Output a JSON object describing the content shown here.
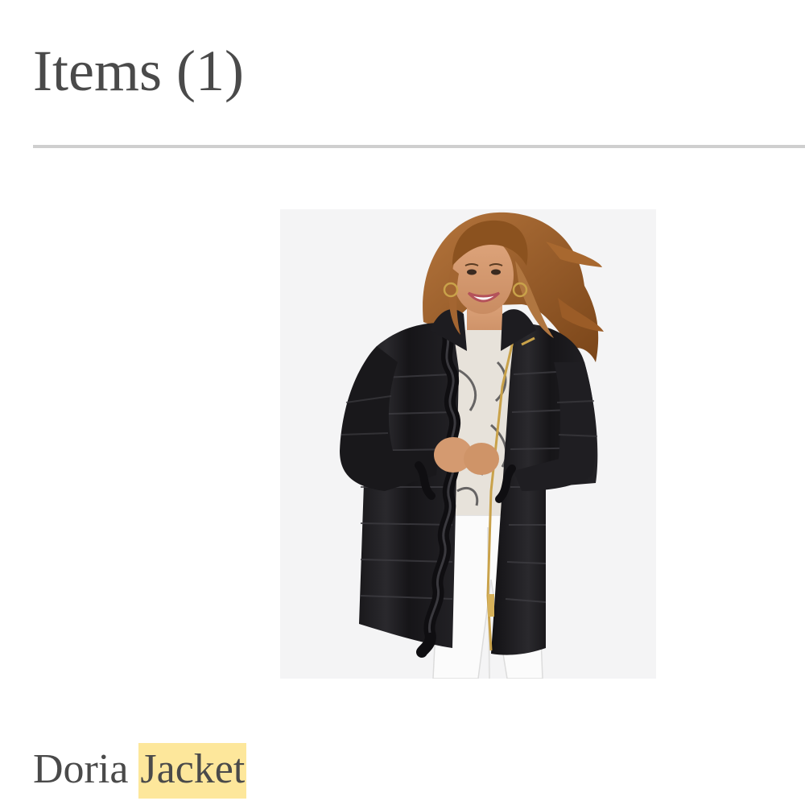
{
  "page": {
    "heading": "Items (1)"
  },
  "product": {
    "name_plain": "Doria",
    "name_highlighted": "Jacket",
    "highlight_color": "#fde79b",
    "image_alt": "Model wearing a long black quilted puffer jacket with ruffle trim, gold zipper, printed top and white jeans"
  },
  "colors": {
    "text": "#4a4a4a",
    "divider": "#cfcfcf",
    "image_background": "#f4f4f5",
    "jacket": "#1b1a1c"
  }
}
